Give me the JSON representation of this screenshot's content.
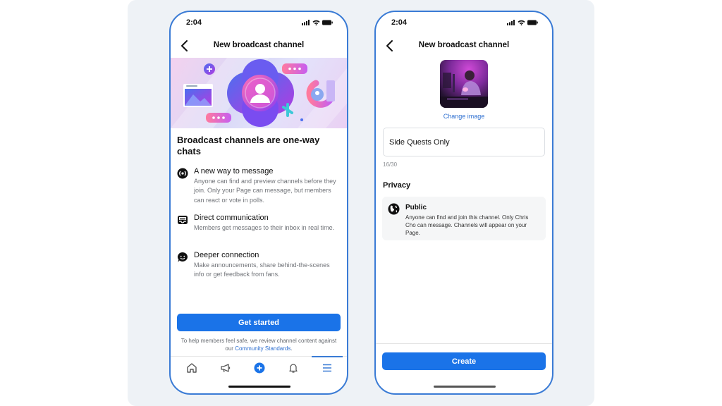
{
  "left_phone": {
    "status": {
      "time": "2:04"
    },
    "nav": {
      "title": "New broadcast channel",
      "back_icon": "chevron-left-icon"
    },
    "headline": "Broadcast channels are one-way chats",
    "features": [
      {
        "icon": "broadcast-icon",
        "title": "A new way to message",
        "description": "Anyone can find and preview channels before they join. Only your Page can message, but members can react or vote in polls."
      },
      {
        "icon": "inbox-icon",
        "title": "Direct communication",
        "description": "Members get messages to their inbox in real time."
      },
      {
        "icon": "smile-chat-icon",
        "title": "Deeper connection",
        "description": "Make announcements, share behind-the-scenes info or get feedback from fans."
      }
    ],
    "primary_button": "Get started",
    "footnote": {
      "text": "To help members feel safe, we review channel content against our ",
      "link": "Community Standards",
      "end": "."
    },
    "tabbar": [
      {
        "name": "home",
        "icon": "home-icon"
      },
      {
        "name": "announcements",
        "icon": "megaphone-icon"
      },
      {
        "name": "create",
        "icon": "plus-circle-icon"
      },
      {
        "name": "notifications",
        "icon": "bell-icon"
      },
      {
        "name": "menu",
        "icon": "menu-icon",
        "active": true
      }
    ]
  },
  "right_phone": {
    "status": {
      "time": "2:04"
    },
    "nav": {
      "title": "New broadcast channel",
      "back_icon": "chevron-left-icon"
    },
    "change_image_label": "Change image",
    "channel_name": {
      "value": "Side Quests Only",
      "counter": "16/30"
    },
    "privacy": {
      "section_title": "Privacy",
      "option_title": "Public",
      "option_description": "Anyone can find and join this channel. Only Chris Cho can message. Channels will appear on your Page."
    },
    "primary_button": "Create"
  },
  "colors": {
    "accent": "#1a73e8",
    "frame": "#3a7bd5",
    "link": "#2d6fd0",
    "backdrop": "#eef2f6"
  }
}
